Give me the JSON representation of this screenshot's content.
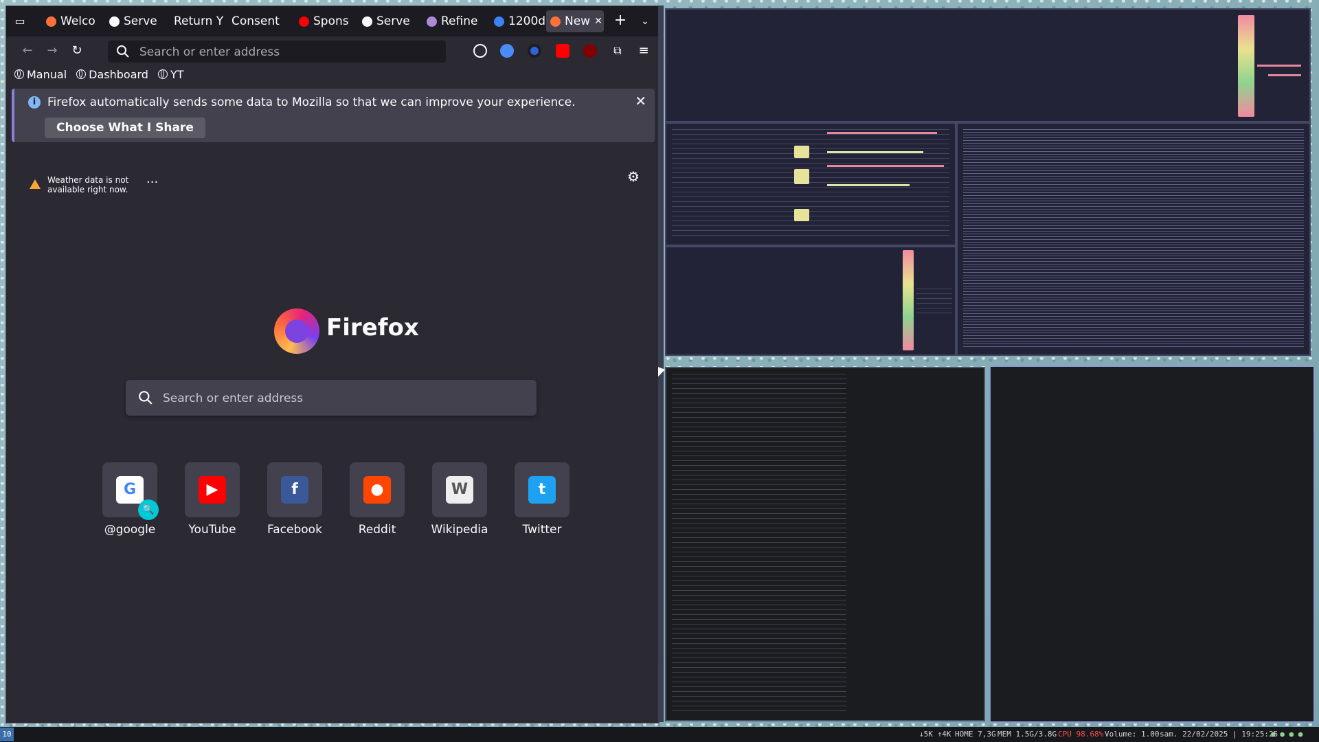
{
  "browser": {
    "tabs": [
      {
        "label": "Welco",
        "icon": "firefox-icon",
        "color": "#ff7139"
      },
      {
        "label": "Serve",
        "icon": "info-icon",
        "color": "#fbfbfe"
      },
      {
        "label": "Return Y",
        "icon": "",
        "color": ""
      },
      {
        "label": "Consent",
        "icon": "",
        "color": ""
      },
      {
        "label": "Spons",
        "icon": "youtube-icon",
        "color": "#ff0000"
      },
      {
        "label": "Serve",
        "icon": "info-icon",
        "color": "#fbfbfe"
      },
      {
        "label": "Refine",
        "icon": "github-icon",
        "color": "#a98bd6"
      },
      {
        "label": "1200d",
        "icon": "circle-icon",
        "color": "#3b82f6"
      },
      {
        "label": "New",
        "icon": "firefox-icon",
        "color": "#ff7139",
        "active": true
      }
    ],
    "url_placeholder": "Search or enter address",
    "bookmarks": [
      "Manual",
      "Dashboard",
      "YT"
    ],
    "notification": {
      "message": "Firefox automatically sends some data to Mozilla so that we can improve your experience.",
      "button": "Choose What I Share"
    },
    "weather": "Weather data is not available right now.",
    "brand": "Firefox",
    "search_placeholder": "Search or enter address",
    "shortcuts": [
      {
        "label": "@google",
        "icon": "google-icon",
        "color": "#ffffff",
        "glyph": "G",
        "glyph_color": "#4285f4"
      },
      {
        "label": "YouTube",
        "icon": "youtube-icon",
        "color": "#ff0000",
        "glyph": "▶",
        "glyph_color": "#ffffff"
      },
      {
        "label": "Facebook",
        "icon": "facebook-icon",
        "color": "#3b5998",
        "glyph": "f",
        "glyph_color": "#ffffff"
      },
      {
        "label": "Reddit",
        "icon": "reddit-icon",
        "color": "#ff4500",
        "glyph": "●",
        "glyph_color": "#ffffff"
      },
      {
        "label": "Wikipedia",
        "icon": "wikipedia-icon",
        "color": "#eeeeee",
        "glyph": "W",
        "glyph_color": "#555555"
      },
      {
        "label": "Twitter",
        "icon": "twitter-icon",
        "color": "#1da1f2",
        "glyph": "t",
        "glyph_color": "#ffffff"
      }
    ]
  },
  "statusbar": {
    "workspace": "10",
    "network": "↓5K ↑4K",
    "home": "HOME 7,3G",
    "mem": "MEM 1.5G/3.8G",
    "cpu": "CPU 98.68%",
    "volume": "Volume: 1.00",
    "datetime": "sam. 22/02/2025 | 19:25:25"
  },
  "colors": {
    "firefox_bg": "#2b2a33",
    "cpu_alert": "#ff4b4b",
    "accent": "#00c8d7"
  }
}
